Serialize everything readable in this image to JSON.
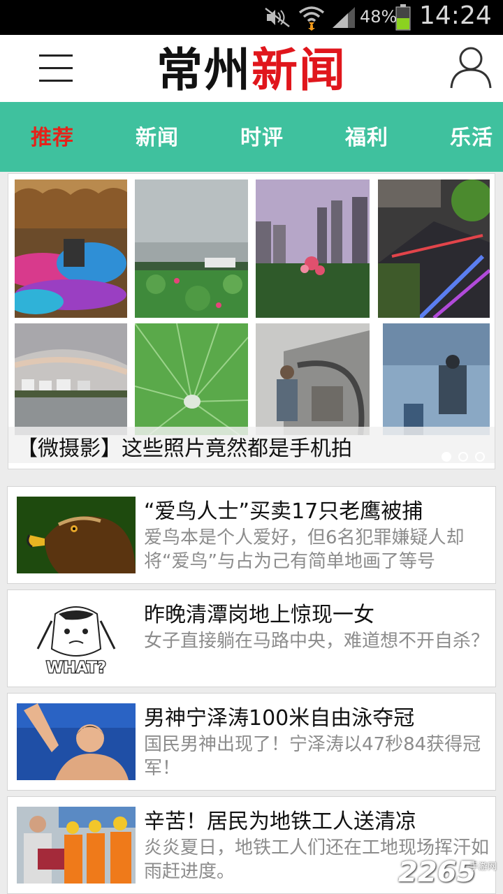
{
  "status_bar": {
    "battery_percent": "48%",
    "time": "14:24",
    "icons": [
      "mute-icon",
      "wifi-icon",
      "signal-icon",
      "battery-icon"
    ]
  },
  "header": {
    "logo_part1": "常州",
    "logo_part2": "新闻",
    "icons": [
      "menu-icon",
      "user-icon"
    ]
  },
  "tabs": [
    {
      "label": "推荐",
      "active": true
    },
    {
      "label": "新闻",
      "active": false
    },
    {
      "label": "时评",
      "active": false
    },
    {
      "label": "福利",
      "active": false
    },
    {
      "label": "乐活",
      "active": false
    }
  ],
  "banner": {
    "caption": "【微摄影】这些照片竟然都是手机拍",
    "pages": 3,
    "current_page": 1
  },
  "news": [
    {
      "title": "“爱鸟人士”买卖17只老鹰被捕",
      "summary": "爱鸟本是个人爱好，但6名犯罪嫌疑人却将“爱鸟”与占为己有简单地画了等号"
    },
    {
      "title": "昨晚清潭岗地上惊现一女",
      "summary": "女子直接躺在马路中央，难道想不开自杀？",
      "thumb_text": "WHAT?"
    },
    {
      "title": "男神宁泽涛100米自由泳夺冠",
      "summary": "国民男神出现了！宁泽涛以47秒84获得冠军！"
    },
    {
      "title": "辛苦！居民为地铁工人送清凉",
      "summary": "炎炎夏日，地铁工人们还在工地现场挥汗如雨赶进度。"
    }
  ],
  "watermark": {
    "number": "2265",
    "suffix": "手游网"
  },
  "colors": {
    "accent": "#3fc19e",
    "active_tab": "#e5221a",
    "logo_red": "#e0161c"
  }
}
